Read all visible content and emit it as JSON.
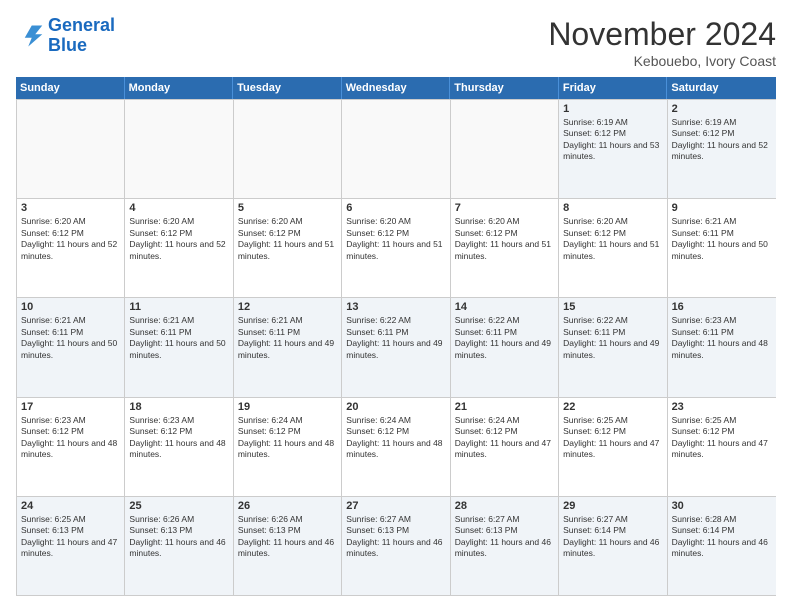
{
  "logo": {
    "line1": "General",
    "line2": "Blue"
  },
  "title": "November 2024",
  "location": "Kebouebo, Ivory Coast",
  "days": [
    "Sunday",
    "Monday",
    "Tuesday",
    "Wednesday",
    "Thursday",
    "Friday",
    "Saturday"
  ],
  "rows": [
    [
      {
        "day": "",
        "info": ""
      },
      {
        "day": "",
        "info": ""
      },
      {
        "day": "",
        "info": ""
      },
      {
        "day": "",
        "info": ""
      },
      {
        "day": "",
        "info": ""
      },
      {
        "day": "1",
        "info": "Sunrise: 6:19 AM\nSunset: 6:12 PM\nDaylight: 11 hours and 53 minutes."
      },
      {
        "day": "2",
        "info": "Sunrise: 6:19 AM\nSunset: 6:12 PM\nDaylight: 11 hours and 52 minutes."
      }
    ],
    [
      {
        "day": "3",
        "info": "Sunrise: 6:20 AM\nSunset: 6:12 PM\nDaylight: 11 hours and 52 minutes."
      },
      {
        "day": "4",
        "info": "Sunrise: 6:20 AM\nSunset: 6:12 PM\nDaylight: 11 hours and 52 minutes."
      },
      {
        "day": "5",
        "info": "Sunrise: 6:20 AM\nSunset: 6:12 PM\nDaylight: 11 hours and 51 minutes."
      },
      {
        "day": "6",
        "info": "Sunrise: 6:20 AM\nSunset: 6:12 PM\nDaylight: 11 hours and 51 minutes."
      },
      {
        "day": "7",
        "info": "Sunrise: 6:20 AM\nSunset: 6:12 PM\nDaylight: 11 hours and 51 minutes."
      },
      {
        "day": "8",
        "info": "Sunrise: 6:20 AM\nSunset: 6:12 PM\nDaylight: 11 hours and 51 minutes."
      },
      {
        "day": "9",
        "info": "Sunrise: 6:21 AM\nSunset: 6:11 PM\nDaylight: 11 hours and 50 minutes."
      }
    ],
    [
      {
        "day": "10",
        "info": "Sunrise: 6:21 AM\nSunset: 6:11 PM\nDaylight: 11 hours and 50 minutes."
      },
      {
        "day": "11",
        "info": "Sunrise: 6:21 AM\nSunset: 6:11 PM\nDaylight: 11 hours and 50 minutes."
      },
      {
        "day": "12",
        "info": "Sunrise: 6:21 AM\nSunset: 6:11 PM\nDaylight: 11 hours and 49 minutes."
      },
      {
        "day": "13",
        "info": "Sunrise: 6:22 AM\nSunset: 6:11 PM\nDaylight: 11 hours and 49 minutes."
      },
      {
        "day": "14",
        "info": "Sunrise: 6:22 AM\nSunset: 6:11 PM\nDaylight: 11 hours and 49 minutes."
      },
      {
        "day": "15",
        "info": "Sunrise: 6:22 AM\nSunset: 6:11 PM\nDaylight: 11 hours and 49 minutes."
      },
      {
        "day": "16",
        "info": "Sunrise: 6:23 AM\nSunset: 6:11 PM\nDaylight: 11 hours and 48 minutes."
      }
    ],
    [
      {
        "day": "17",
        "info": "Sunrise: 6:23 AM\nSunset: 6:12 PM\nDaylight: 11 hours and 48 minutes."
      },
      {
        "day": "18",
        "info": "Sunrise: 6:23 AM\nSunset: 6:12 PM\nDaylight: 11 hours and 48 minutes."
      },
      {
        "day": "19",
        "info": "Sunrise: 6:24 AM\nSunset: 6:12 PM\nDaylight: 11 hours and 48 minutes."
      },
      {
        "day": "20",
        "info": "Sunrise: 6:24 AM\nSunset: 6:12 PM\nDaylight: 11 hours and 48 minutes."
      },
      {
        "day": "21",
        "info": "Sunrise: 6:24 AM\nSunset: 6:12 PM\nDaylight: 11 hours and 47 minutes."
      },
      {
        "day": "22",
        "info": "Sunrise: 6:25 AM\nSunset: 6:12 PM\nDaylight: 11 hours and 47 minutes."
      },
      {
        "day": "23",
        "info": "Sunrise: 6:25 AM\nSunset: 6:12 PM\nDaylight: 11 hours and 47 minutes."
      }
    ],
    [
      {
        "day": "24",
        "info": "Sunrise: 6:25 AM\nSunset: 6:13 PM\nDaylight: 11 hours and 47 minutes."
      },
      {
        "day": "25",
        "info": "Sunrise: 6:26 AM\nSunset: 6:13 PM\nDaylight: 11 hours and 46 minutes."
      },
      {
        "day": "26",
        "info": "Sunrise: 6:26 AM\nSunset: 6:13 PM\nDaylight: 11 hours and 46 minutes."
      },
      {
        "day": "27",
        "info": "Sunrise: 6:27 AM\nSunset: 6:13 PM\nDaylight: 11 hours and 46 minutes."
      },
      {
        "day": "28",
        "info": "Sunrise: 6:27 AM\nSunset: 6:13 PM\nDaylight: 11 hours and 46 minutes."
      },
      {
        "day": "29",
        "info": "Sunrise: 6:27 AM\nSunset: 6:14 PM\nDaylight: 11 hours and 46 minutes."
      },
      {
        "day": "30",
        "info": "Sunrise: 6:28 AM\nSunset: 6:14 PM\nDaylight: 11 hours and 46 minutes."
      }
    ]
  ]
}
